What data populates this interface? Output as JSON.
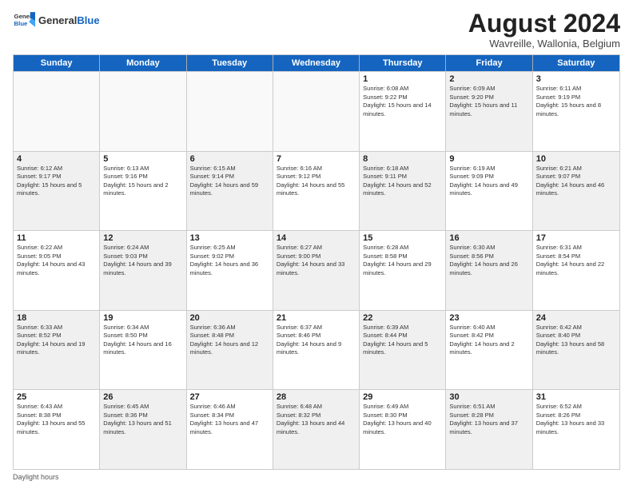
{
  "header": {
    "logo_general": "General",
    "logo_blue": "Blue",
    "title": "August 2024",
    "subtitle": "Wavreille, Wallonia, Belgium"
  },
  "days": [
    "Sunday",
    "Monday",
    "Tuesday",
    "Wednesday",
    "Thursday",
    "Friday",
    "Saturday"
  ],
  "weeks": [
    [
      {
        "day": "",
        "empty": true,
        "shaded": false,
        "sunrise": "",
        "sunset": "",
        "daylight": ""
      },
      {
        "day": "",
        "empty": true,
        "shaded": false,
        "sunrise": "",
        "sunset": "",
        "daylight": ""
      },
      {
        "day": "",
        "empty": true,
        "shaded": false,
        "sunrise": "",
        "sunset": "",
        "daylight": ""
      },
      {
        "day": "",
        "empty": true,
        "shaded": false,
        "sunrise": "",
        "sunset": "",
        "daylight": ""
      },
      {
        "day": "1",
        "empty": false,
        "shaded": false,
        "sunrise": "Sunrise: 6:08 AM",
        "sunset": "Sunset: 9:22 PM",
        "daylight": "Daylight: 15 hours and 14 minutes."
      },
      {
        "day": "2",
        "empty": false,
        "shaded": true,
        "sunrise": "Sunrise: 6:09 AM",
        "sunset": "Sunset: 9:20 PM",
        "daylight": "Daylight: 15 hours and 11 minutes."
      },
      {
        "day": "3",
        "empty": false,
        "shaded": false,
        "sunrise": "Sunrise: 6:11 AM",
        "sunset": "Sunset: 9:19 PM",
        "daylight": "Daylight: 15 hours and 8 minutes."
      }
    ],
    [
      {
        "day": "4",
        "empty": false,
        "shaded": true,
        "sunrise": "Sunrise: 6:12 AM",
        "sunset": "Sunset: 9:17 PM",
        "daylight": "Daylight: 15 hours and 5 minutes."
      },
      {
        "day": "5",
        "empty": false,
        "shaded": false,
        "sunrise": "Sunrise: 6:13 AM",
        "sunset": "Sunset: 9:16 PM",
        "daylight": "Daylight: 15 hours and 2 minutes."
      },
      {
        "day": "6",
        "empty": false,
        "shaded": true,
        "sunrise": "Sunrise: 6:15 AM",
        "sunset": "Sunset: 9:14 PM",
        "daylight": "Daylight: 14 hours and 59 minutes."
      },
      {
        "day": "7",
        "empty": false,
        "shaded": false,
        "sunrise": "Sunrise: 6:16 AM",
        "sunset": "Sunset: 9:12 PM",
        "daylight": "Daylight: 14 hours and 55 minutes."
      },
      {
        "day": "8",
        "empty": false,
        "shaded": true,
        "sunrise": "Sunrise: 6:18 AM",
        "sunset": "Sunset: 9:11 PM",
        "daylight": "Daylight: 14 hours and 52 minutes."
      },
      {
        "day": "9",
        "empty": false,
        "shaded": false,
        "sunrise": "Sunrise: 6:19 AM",
        "sunset": "Sunset: 9:09 PM",
        "daylight": "Daylight: 14 hours and 49 minutes."
      },
      {
        "day": "10",
        "empty": false,
        "shaded": true,
        "sunrise": "Sunrise: 6:21 AM",
        "sunset": "Sunset: 9:07 PM",
        "daylight": "Daylight: 14 hours and 46 minutes."
      }
    ],
    [
      {
        "day": "11",
        "empty": false,
        "shaded": false,
        "sunrise": "Sunrise: 6:22 AM",
        "sunset": "Sunset: 9:05 PM",
        "daylight": "Daylight: 14 hours and 43 minutes."
      },
      {
        "day": "12",
        "empty": false,
        "shaded": true,
        "sunrise": "Sunrise: 6:24 AM",
        "sunset": "Sunset: 9:03 PM",
        "daylight": "Daylight: 14 hours and 39 minutes."
      },
      {
        "day": "13",
        "empty": false,
        "shaded": false,
        "sunrise": "Sunrise: 6:25 AM",
        "sunset": "Sunset: 9:02 PM",
        "daylight": "Daylight: 14 hours and 36 minutes."
      },
      {
        "day": "14",
        "empty": false,
        "shaded": true,
        "sunrise": "Sunrise: 6:27 AM",
        "sunset": "Sunset: 9:00 PM",
        "daylight": "Daylight: 14 hours and 33 minutes."
      },
      {
        "day": "15",
        "empty": false,
        "shaded": false,
        "sunrise": "Sunrise: 6:28 AM",
        "sunset": "Sunset: 8:58 PM",
        "daylight": "Daylight: 14 hours and 29 minutes."
      },
      {
        "day": "16",
        "empty": false,
        "shaded": true,
        "sunrise": "Sunrise: 6:30 AM",
        "sunset": "Sunset: 8:56 PM",
        "daylight": "Daylight: 14 hours and 26 minutes."
      },
      {
        "day": "17",
        "empty": false,
        "shaded": false,
        "sunrise": "Sunrise: 6:31 AM",
        "sunset": "Sunset: 8:54 PM",
        "daylight": "Daylight: 14 hours and 22 minutes."
      }
    ],
    [
      {
        "day": "18",
        "empty": false,
        "shaded": true,
        "sunrise": "Sunrise: 6:33 AM",
        "sunset": "Sunset: 8:52 PM",
        "daylight": "Daylight: 14 hours and 19 minutes."
      },
      {
        "day": "19",
        "empty": false,
        "shaded": false,
        "sunrise": "Sunrise: 6:34 AM",
        "sunset": "Sunset: 8:50 PM",
        "daylight": "Daylight: 14 hours and 16 minutes."
      },
      {
        "day": "20",
        "empty": false,
        "shaded": true,
        "sunrise": "Sunrise: 6:36 AM",
        "sunset": "Sunset: 8:48 PM",
        "daylight": "Daylight: 14 hours and 12 minutes."
      },
      {
        "day": "21",
        "empty": false,
        "shaded": false,
        "sunrise": "Sunrise: 6:37 AM",
        "sunset": "Sunset: 8:46 PM",
        "daylight": "Daylight: 14 hours and 9 minutes."
      },
      {
        "day": "22",
        "empty": false,
        "shaded": true,
        "sunrise": "Sunrise: 6:39 AM",
        "sunset": "Sunset: 8:44 PM",
        "daylight": "Daylight: 14 hours and 5 minutes."
      },
      {
        "day": "23",
        "empty": false,
        "shaded": false,
        "sunrise": "Sunrise: 6:40 AM",
        "sunset": "Sunset: 8:42 PM",
        "daylight": "Daylight: 14 hours and 2 minutes."
      },
      {
        "day": "24",
        "empty": false,
        "shaded": true,
        "sunrise": "Sunrise: 6:42 AM",
        "sunset": "Sunset: 8:40 PM",
        "daylight": "Daylight: 13 hours and 58 minutes."
      }
    ],
    [
      {
        "day": "25",
        "empty": false,
        "shaded": false,
        "sunrise": "Sunrise: 6:43 AM",
        "sunset": "Sunset: 8:38 PM",
        "daylight": "Daylight: 13 hours and 55 minutes."
      },
      {
        "day": "26",
        "empty": false,
        "shaded": true,
        "sunrise": "Sunrise: 6:45 AM",
        "sunset": "Sunset: 8:36 PM",
        "daylight": "Daylight: 13 hours and 51 minutes."
      },
      {
        "day": "27",
        "empty": false,
        "shaded": false,
        "sunrise": "Sunrise: 6:46 AM",
        "sunset": "Sunset: 8:34 PM",
        "daylight": "Daylight: 13 hours and 47 minutes."
      },
      {
        "day": "28",
        "empty": false,
        "shaded": true,
        "sunrise": "Sunrise: 6:48 AM",
        "sunset": "Sunset: 8:32 PM",
        "daylight": "Daylight: 13 hours and 44 minutes."
      },
      {
        "day": "29",
        "empty": false,
        "shaded": false,
        "sunrise": "Sunrise: 6:49 AM",
        "sunset": "Sunset: 8:30 PM",
        "daylight": "Daylight: 13 hours and 40 minutes."
      },
      {
        "day": "30",
        "empty": false,
        "shaded": true,
        "sunrise": "Sunrise: 6:51 AM",
        "sunset": "Sunset: 8:28 PM",
        "daylight": "Daylight: 13 hours and 37 minutes."
      },
      {
        "day": "31",
        "empty": false,
        "shaded": false,
        "sunrise": "Sunrise: 6:52 AM",
        "sunset": "Sunset: 8:26 PM",
        "daylight": "Daylight: 13 hours and 33 minutes."
      }
    ]
  ],
  "footer": "Daylight hours"
}
